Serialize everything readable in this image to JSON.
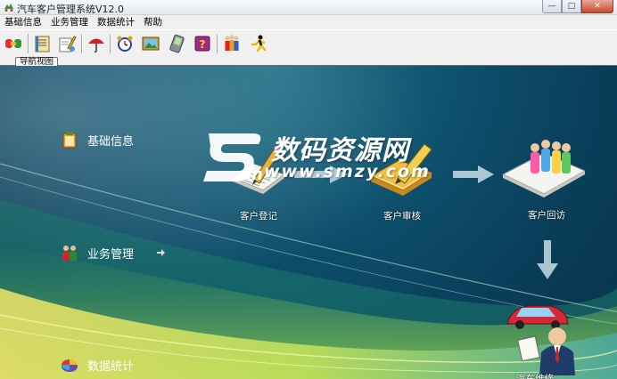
{
  "window": {
    "title": "汽车客户管理系统V12.0",
    "controls": {
      "minimize": "—",
      "maximize": "□",
      "close": "✕"
    }
  },
  "menu": [
    {
      "label": "基础信息"
    },
    {
      "label": "业务管理"
    },
    {
      "label": "数据统计"
    },
    {
      "label": "帮助"
    }
  ],
  "toolbar": {
    "icons": [
      "link-icon",
      "notebook-icon",
      "document-edit-icon",
      "umbrella-icon",
      "alarm-clock-icon",
      "picture-icon",
      "pda-icon",
      "help-book-icon",
      "people-group-icon",
      "running-man-icon"
    ]
  },
  "tabs": [
    {
      "label": "导航视图"
    }
  ],
  "nav": {
    "items": [
      {
        "label": "基础信息",
        "icon": "clipboard-icon"
      },
      {
        "label": "业务管理",
        "icon": "business-people-icon"
      },
      {
        "label": "数据统计",
        "icon": "pie-chart-icon"
      }
    ]
  },
  "flow": {
    "nodes": [
      {
        "label": "客户登记",
        "icon": "notebook-pen-icon"
      },
      {
        "label": "客户审核",
        "icon": "notepad-pencil-icon"
      },
      {
        "label": "客户回访",
        "icon": "people-chart-icon"
      },
      {
        "label": "汽车维修",
        "icon": "car-service-man-icon"
      }
    ]
  },
  "watermark": {
    "title": "数码资源网",
    "url": "www.smzy.com",
    "logo": "Sm"
  },
  "colors": {
    "background_teal": "#0d4f6c",
    "wave_green": "#9ed64a",
    "wave_yellow": "#f2e46b",
    "arrow": "#c8dde8",
    "close_button": "#c9472d"
  }
}
